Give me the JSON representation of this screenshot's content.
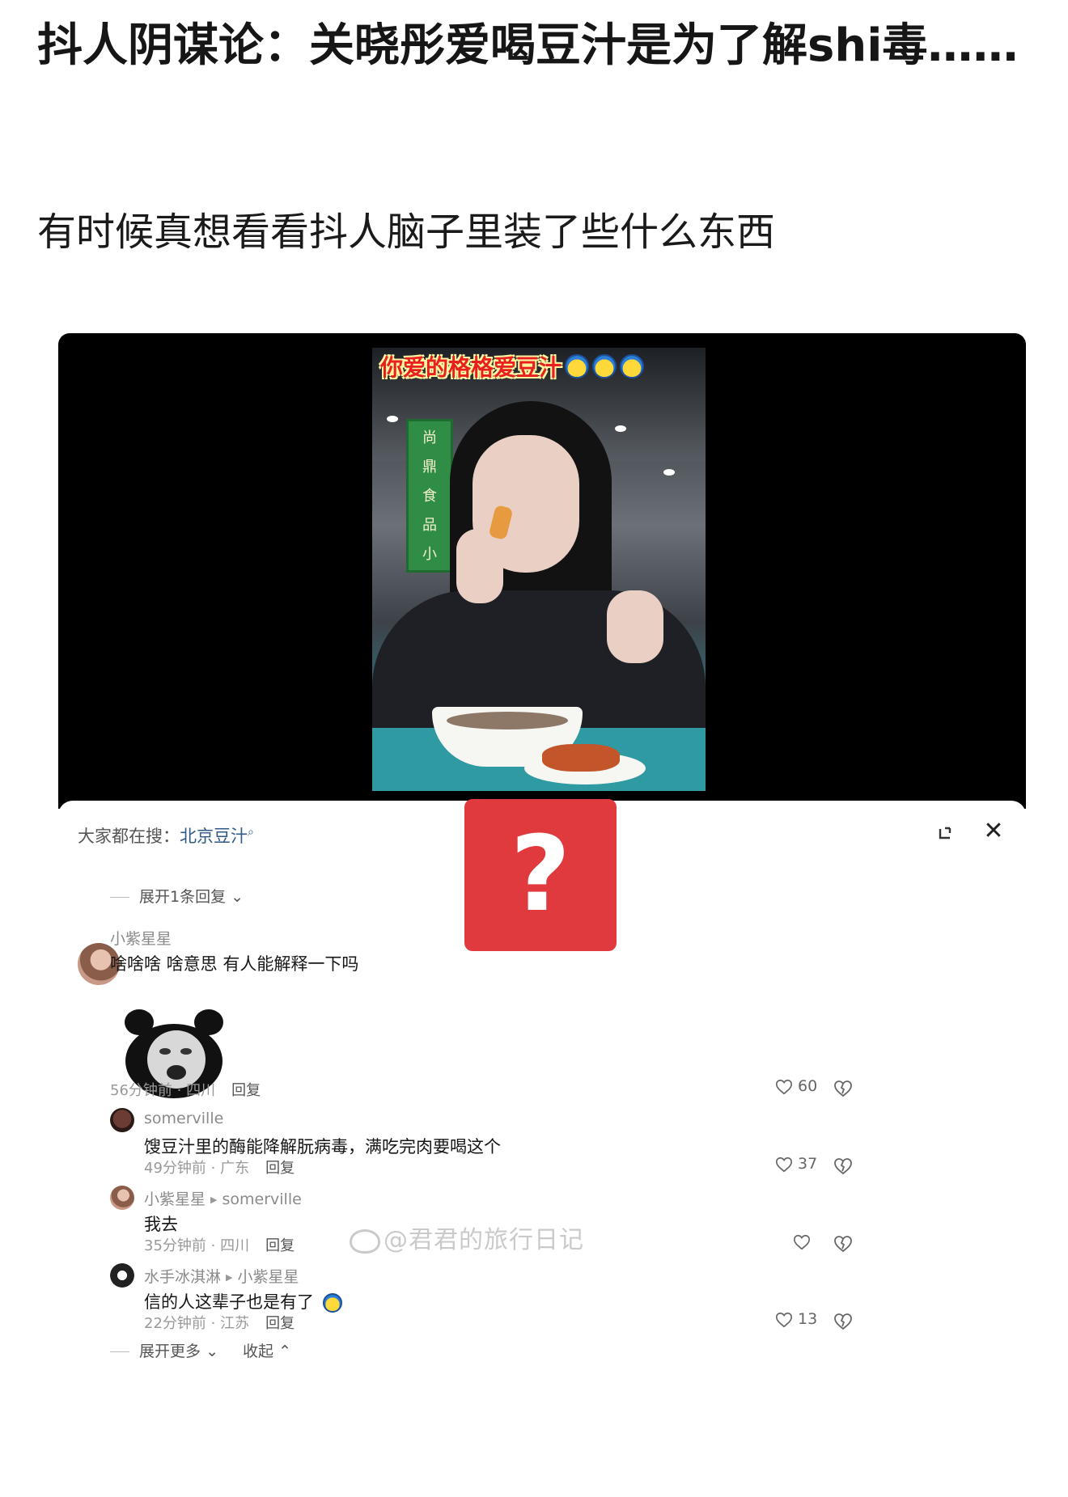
{
  "post": {
    "title": "抖人阴谋论：关晓彤爱喝豆汁是为了解shi毒……",
    "body": "有时候真想看看抖人脑子里装了些什么东西"
  },
  "video": {
    "caption": "你爱的格格爱豆汁",
    "sign_text": [
      "尚",
      "鼎",
      "食",
      "品",
      "小"
    ]
  },
  "panel": {
    "search_prefix": "大家都在搜：",
    "search_keyword": "北京豆汁",
    "expand_replies": "展开1条回复",
    "expand_more": "展开更多",
    "collapse": "收起",
    "reply_label": "回复"
  },
  "overlay": {
    "symbol": "?"
  },
  "comments": [
    {
      "user": "小紫星星",
      "text": "啥啥啥 啥意思 有人能解释一下吗",
      "time": "56分钟前 · 四川",
      "likes": "60",
      "has_sticker": true
    },
    {
      "user": "somerville",
      "text": "馊豆汁里的酶能降解朊病毒，满吃完肉要喝这个",
      "time": "49分钟前 · 广东",
      "likes": "37"
    },
    {
      "user": "小紫星星",
      "reply_to": "somerville",
      "text": "我去",
      "time": "35分钟前 · 四川",
      "likes": ""
    },
    {
      "user": "水手冰淇淋",
      "reply_to": "小紫星星",
      "text": "信的人这辈子也是有了",
      "time": "22分钟前 · 江苏",
      "likes": "13"
    }
  ],
  "watermark": "@君君的旅行日记",
  "colors": {
    "accent_red": "#e03a3e",
    "link_blue": "#2f5a86",
    "video_bg": "#000000"
  }
}
